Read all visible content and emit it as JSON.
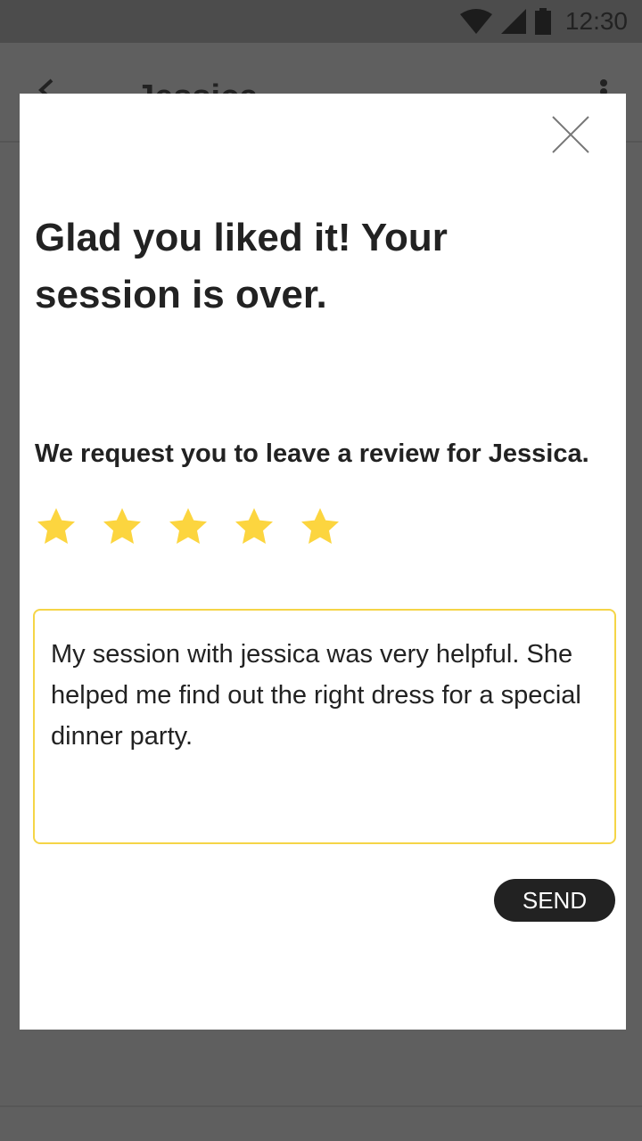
{
  "status_bar": {
    "time": "12:30",
    "icons": [
      "wifi-icon",
      "signal-icon",
      "battery-icon"
    ]
  },
  "app_bar": {
    "title": "Jessica"
  },
  "dialog": {
    "headline": "Glad you liked it! Your session is over.",
    "prompt": "We request you to leave a review for Jessica.",
    "rating": {
      "value": 5,
      "max": 5,
      "star_color": "#fcd53f"
    },
    "review_text": "My session with jessica was very helpful. She helped me find out the right dress for a special dinner party.",
    "send_label": "SEND"
  },
  "colors": {
    "accent": "#f5d547",
    "button": "#222222",
    "overlay": "#5f5f5f"
  }
}
